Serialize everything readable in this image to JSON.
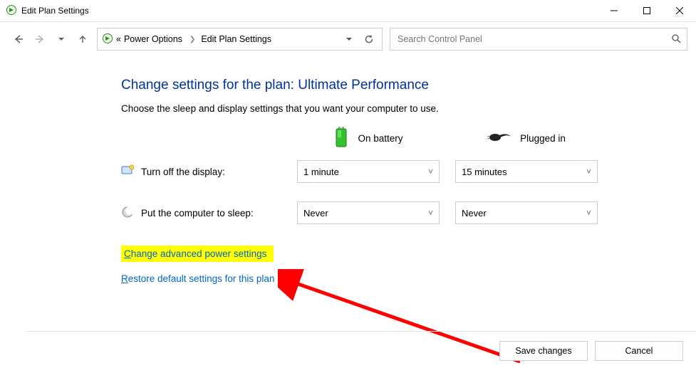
{
  "window": {
    "title": "Edit Plan Settings"
  },
  "breadcrumb": {
    "prefix": "«",
    "items": [
      "Power Options",
      "Edit Plan Settings"
    ]
  },
  "search": {
    "placeholder": "Search Control Panel"
  },
  "heading": {
    "prefix": "Change settings for the plan: ",
    "plan_name": "Ultimate Performance"
  },
  "subtitle": "Choose the sleep and display settings that you want your computer to use.",
  "columns": {
    "battery": "On battery",
    "plugged": "Plugged in"
  },
  "rows": {
    "display": {
      "label": "Turn off the display:",
      "battery": "1 minute",
      "plugged": "15 minutes"
    },
    "sleep": {
      "label": "Put the computer to sleep:",
      "battery": "Never",
      "plugged": "Never"
    }
  },
  "links": {
    "advanced": "Change advanced power settings",
    "advanced_mnemonic": "C",
    "restore": "Restore default settings for this plan",
    "restore_mnemonic": "R"
  },
  "buttons": {
    "save": "Save changes",
    "cancel": "Cancel"
  }
}
